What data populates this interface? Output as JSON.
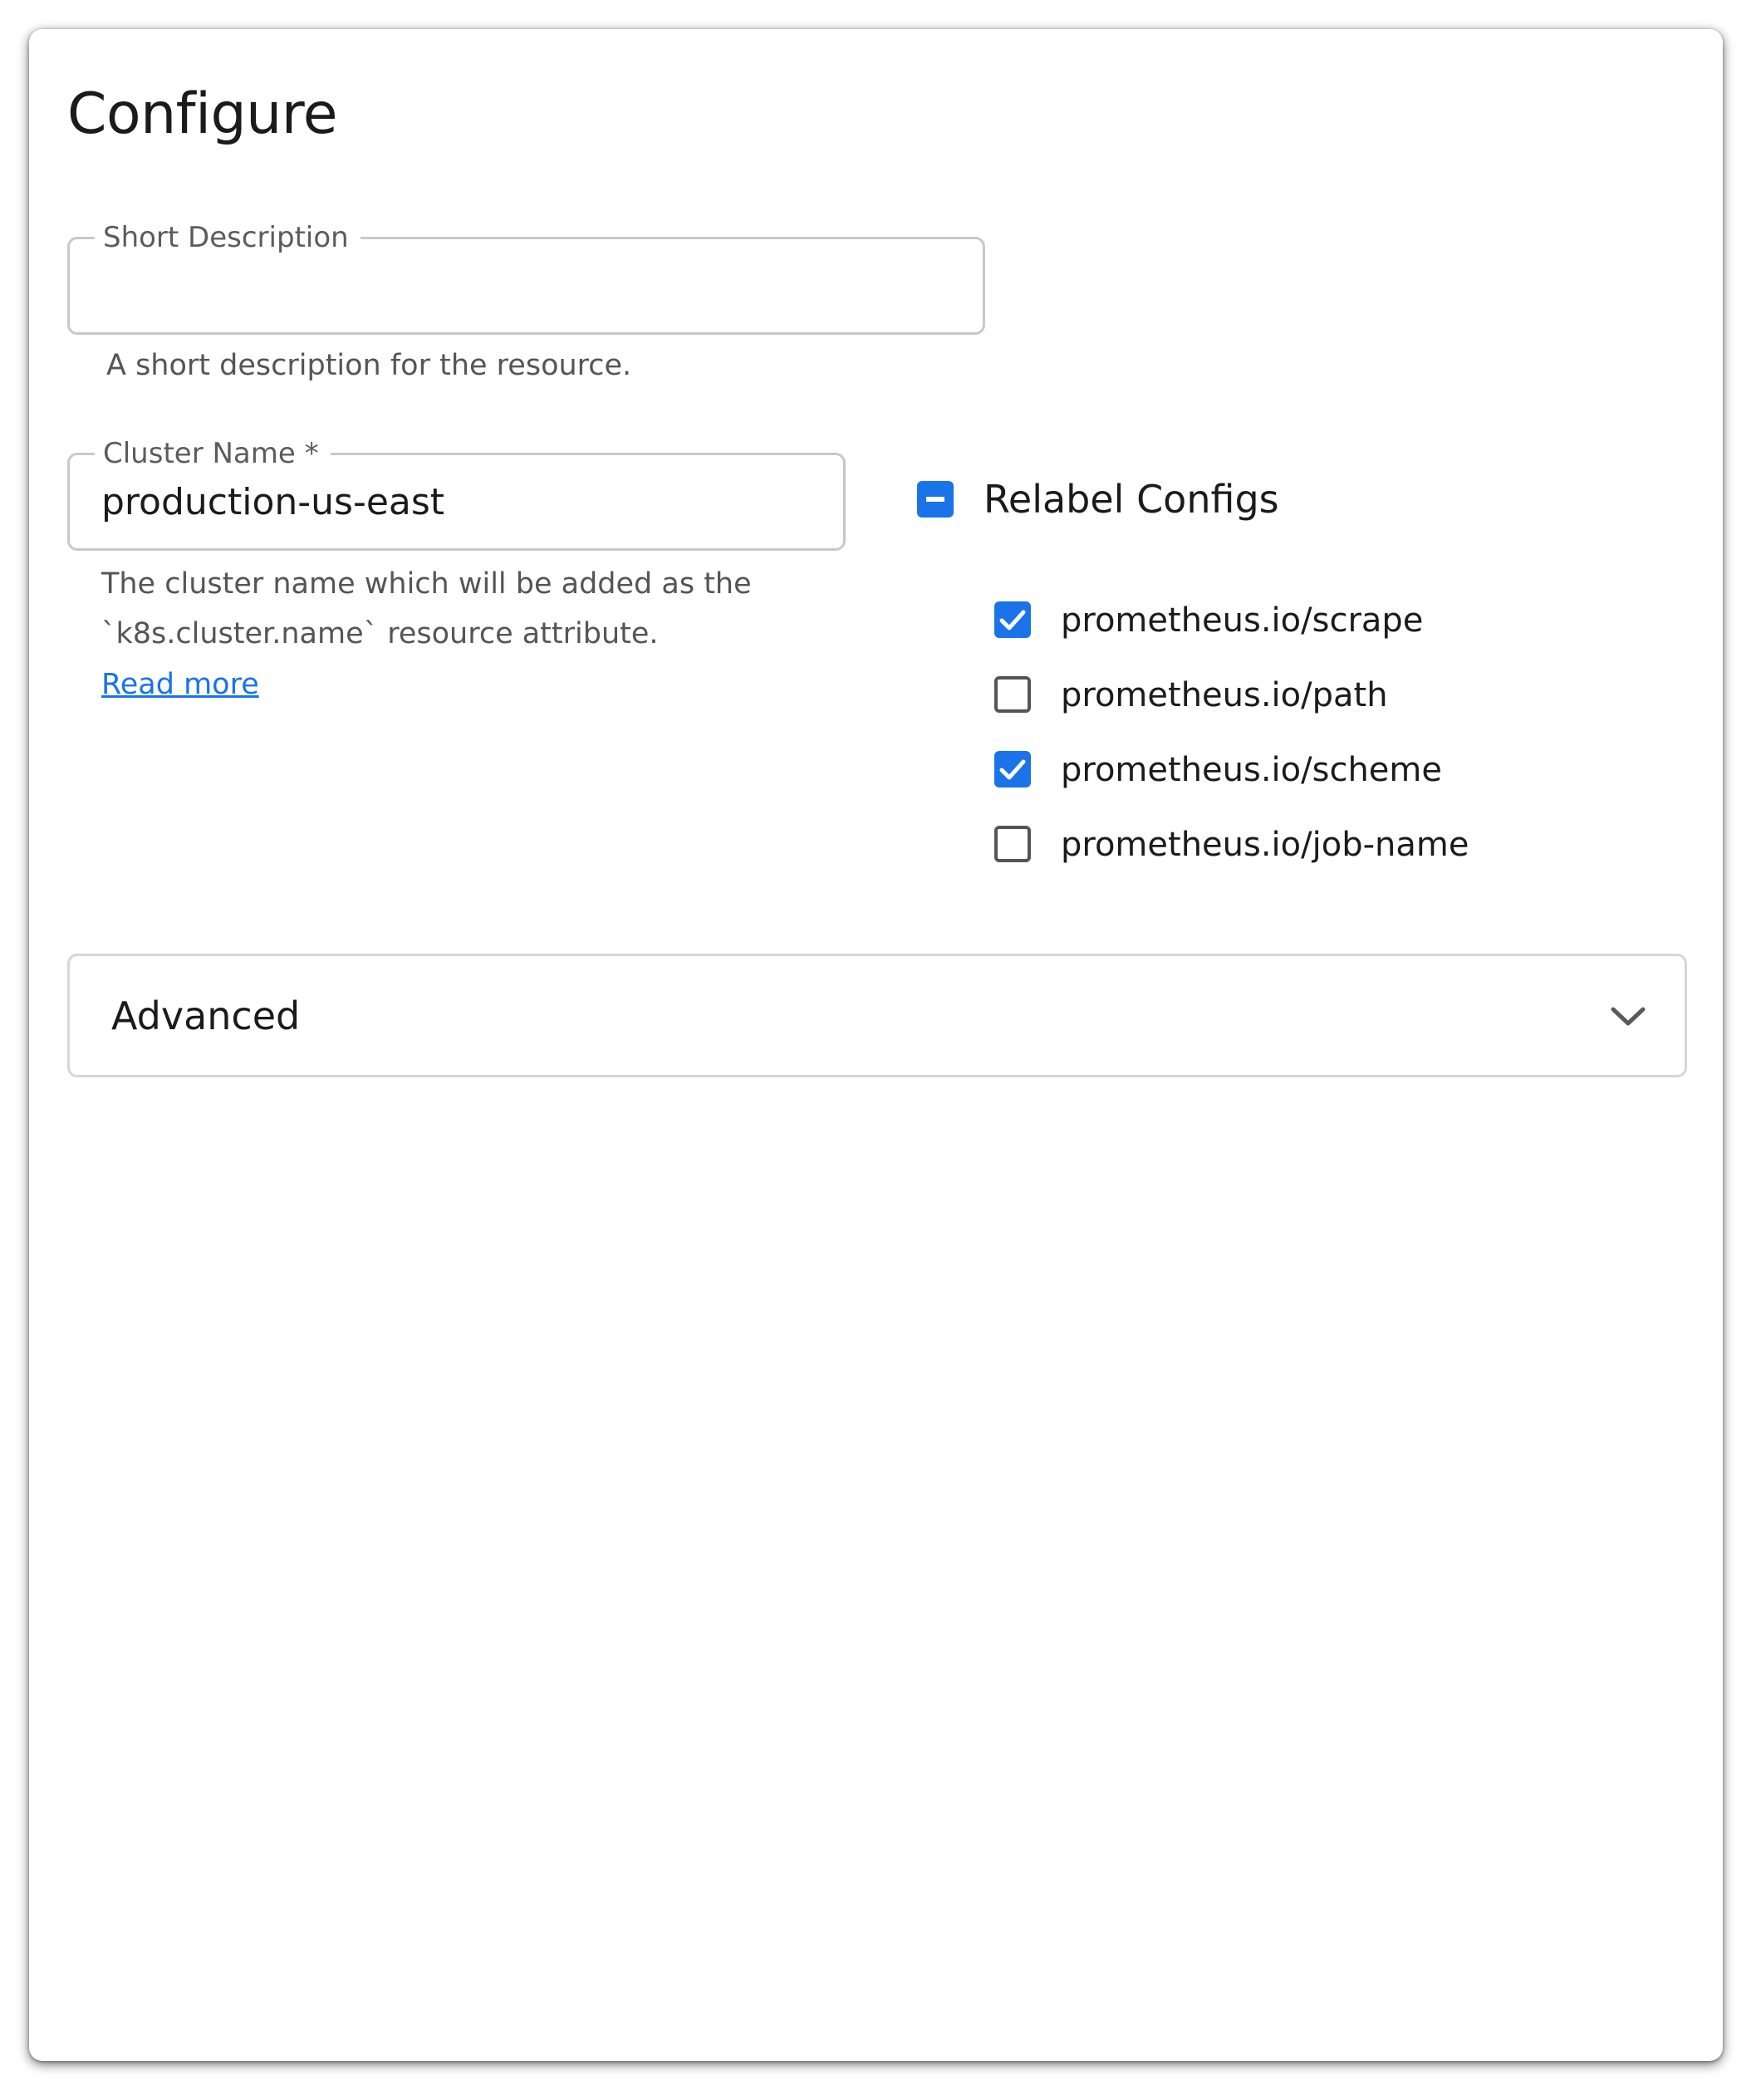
{
  "title": "Configure",
  "short_description": {
    "label": "Short Description",
    "value": "",
    "helper": "A short description for the resource."
  },
  "cluster_name": {
    "label": "Cluster Name *",
    "value": "production-us-east",
    "helper_line1": "The cluster name which will be added as the",
    "helper_line2": "`k8s.cluster.name` resource attribute.",
    "link": "Read more"
  },
  "relabel": {
    "label": "Relabel Configs",
    "state": "indeterminate",
    "items": [
      {
        "label": "prometheus.io/scrape",
        "checked": true
      },
      {
        "label": "prometheus.io/path",
        "checked": false
      },
      {
        "label": "prometheus.io/scheme",
        "checked": true
      },
      {
        "label": "prometheus.io/job-name",
        "checked": false
      }
    ]
  },
  "advanced": {
    "label": "Advanced",
    "icon": "chevron-down-icon"
  },
  "colors": {
    "accent": "#1a73e8"
  }
}
